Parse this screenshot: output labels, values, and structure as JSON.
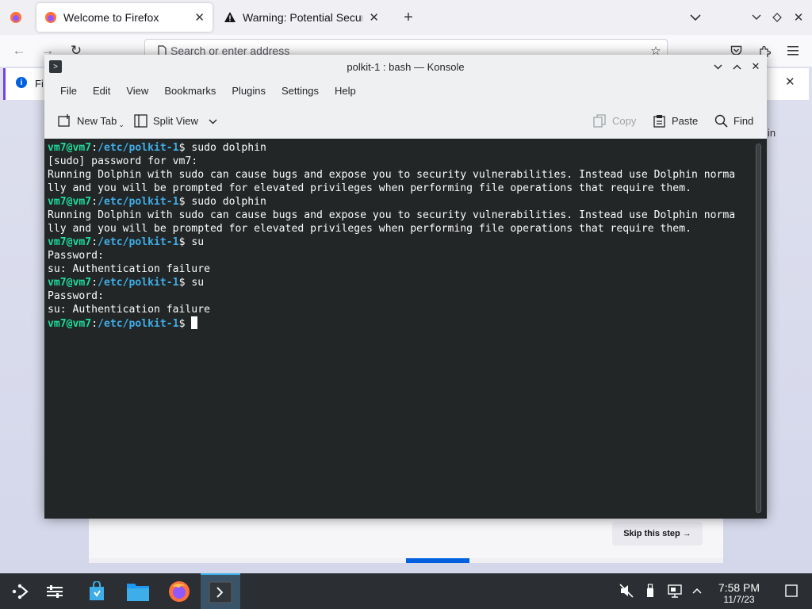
{
  "firefox": {
    "tabs": [
      {
        "label": "Welcome to Firefox",
        "icon": "firefox-logo-icon"
      },
      {
        "label": "Warning: Potential Security",
        "icon": "warning-icon"
      }
    ],
    "url_placeholder": "Search or enter address",
    "notice_text": "Fi",
    "side_text": "in",
    "skip_label": "Skip this step →",
    "onboarding_progress": 0.1,
    "colors": {
      "accent": "#0060df",
      "notice_bar": "#7542e5"
    }
  },
  "konsole": {
    "title": "polkit-1 : bash — Konsole",
    "menu": [
      "File",
      "Edit",
      "View",
      "Bookmarks",
      "Plugins",
      "Settings",
      "Help"
    ],
    "toolbar": {
      "new_tab": "New Tab",
      "split_view": "Split View",
      "copy": "Copy",
      "paste": "Paste",
      "find": "Find"
    },
    "terminal": {
      "prompt_user": "vm7@vm7",
      "prompt_sep": ":",
      "prompt_path": "/etc/polkit-1",
      "prompt_end": "$ ",
      "lines": [
        {
          "type": "prompt",
          "cmd": "sudo dolphin"
        },
        {
          "type": "out",
          "text": "[sudo] password for vm7:"
        },
        {
          "type": "out",
          "text": "Running Dolphin with sudo can cause bugs and expose you to security vulnerabilities. Instead use Dolphin norma"
        },
        {
          "type": "out",
          "text": "lly and you will be prompted for elevated privileges when performing file operations that require them."
        },
        {
          "type": "prompt",
          "cmd": "sudo dolphin"
        },
        {
          "type": "out",
          "text": "Running Dolphin with sudo can cause bugs and expose you to security vulnerabilities. Instead use Dolphin norma"
        },
        {
          "type": "out",
          "text": "lly and you will be prompted for elevated privileges when performing file operations that require them."
        },
        {
          "type": "prompt",
          "cmd": "su"
        },
        {
          "type": "out",
          "text": "Password:"
        },
        {
          "type": "out",
          "text": "su: Authentication failure"
        },
        {
          "type": "prompt",
          "cmd": "su"
        },
        {
          "type": "out",
          "text": "Password:"
        },
        {
          "type": "out",
          "text": "su: Authentication failure"
        },
        {
          "type": "prompt",
          "cmd": "",
          "cursor": true
        }
      ],
      "colors": {
        "background": "#232627",
        "user": "#1cdc9a",
        "path": "#3daee9"
      }
    }
  },
  "taskbar": {
    "time": "7:58 PM",
    "date": "11/7/23",
    "colors": {
      "background": "#2b2f33",
      "active": "#3daee9"
    }
  }
}
